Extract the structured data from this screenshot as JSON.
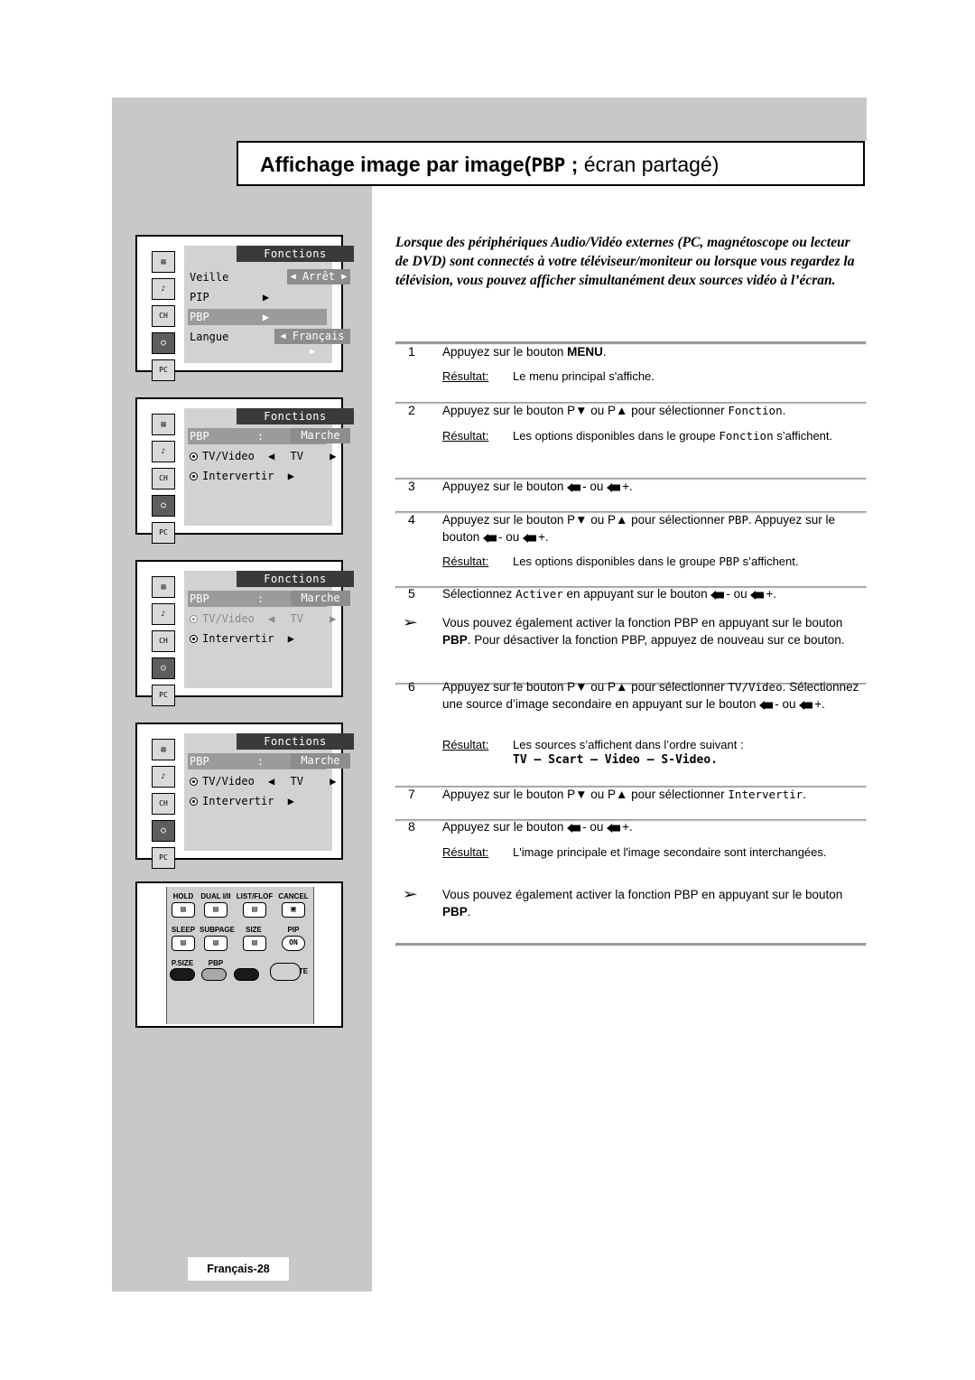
{
  "title": {
    "main": "Affichage image par image",
    "paren_open": "(",
    "mono": "PBP",
    "semi": " ; ",
    "light": "écran partagé",
    "paren_close": ")"
  },
  "intro": "Lorsque des périphériques Audio/Vidéo externes (PC, magnétoscope ou lecteur de DVD) sont connectés à votre téléviseur/moniteur ou lorsque vous regardez la télévision, vous pouvez afficher simultanément deux sources vidéo à l’écran.",
  "osd_panels": [
    {
      "name": "menu-fonctions-veille",
      "title": "Fonctions",
      "rows": [
        {
          "label": "Veille",
          "value": "Arrêt",
          "arrows": true,
          "highlight": false
        },
        {
          "label": "PIP",
          "value": "",
          "arrow_right": true,
          "highlight": false
        },
        {
          "label": "PBP",
          "value": "",
          "arrow_right": true,
          "highlight": true
        },
        {
          "label": "Langue",
          "value": "Français",
          "arrows": true,
          "highlight": false
        }
      ]
    },
    {
      "name": "menu-pbp-marche",
      "title": "Fonctions",
      "rows": [
        {
          "label": "PBP",
          "sep": ":",
          "value": "Marche",
          "highlight": true
        },
        {
          "label": "TV/Video",
          "value": "TV",
          "radio": true,
          "arrows": true
        },
        {
          "label": "Intervertir",
          "radio": true,
          "arrow_right": true
        }
      ]
    },
    {
      "name": "menu-pbp-tvvideo-dim",
      "title": "Fonctions",
      "rows": [
        {
          "label": "PBP",
          "sep": ":",
          "value": "Marche",
          "highlight": true
        },
        {
          "label": "TV/Video",
          "value": "TV",
          "radio": true,
          "arrows": true,
          "dim": true
        },
        {
          "label": "Intervertir",
          "radio": true,
          "arrow_right": true
        }
      ]
    },
    {
      "name": "menu-pbp-intervertir",
      "title": "Fonctions",
      "rows": [
        {
          "label": "PBP",
          "sep": ":",
          "value": "Marche",
          "highlight": true
        },
        {
          "label": "TV/Video",
          "value": "TV",
          "radio": true,
          "arrows": true
        },
        {
          "label": "Intervertir",
          "radio": true,
          "arrow_right": true
        }
      ]
    }
  ],
  "remote": {
    "name": "remote-control-diagram",
    "rows": [
      [
        "HOLD",
        "DUAL I/II",
        "LIST/FLOF",
        "CANCEL"
      ],
      [
        "SLEEP",
        "SUBPAGE",
        "SIZE",
        "PIP"
      ],
      [
        "P.SIZE",
        "PBP",
        "",
        "LOCATE"
      ]
    ],
    "pip_on_label": "ON"
  },
  "steps": [
    {
      "num": "1",
      "text_pre": "Appuyez sur le bouton ",
      "text_bold": "MENU",
      "text_post": ".",
      "result_label": "Résultat:",
      "result": "Le menu principal s'affiche."
    },
    {
      "num": "2",
      "text_pre": "Appuyez sur le bouton P▼ ou P▲ pour sélectionner ",
      "text_mono": "Fonction",
      "text_post": ".",
      "result_label": "Résultat:",
      "result_pre": "Les options disponibles dans le groupe ",
      "result_mono": "Fonction",
      "result_post": " s’affichent."
    },
    {
      "num": "3",
      "text_pre": "Appuyez sur le bouton ",
      "text_mid": "- ou ",
      "text_post": "+."
    },
    {
      "num": "4",
      "text_pre": "Appuyez sur le bouton P▼ ou P▲ pour sélectionner ",
      "text_mono": "PBP",
      "text_post": ". Appuyez sur le bouton ",
      "text_mid": "- ou ",
      "text_end": "+.",
      "result_label": "Résultat:",
      "result_pre": "Les options disponibles dans le groupe ",
      "result_mono": "PBP",
      "result_post": " s’affichent."
    },
    {
      "num": "5",
      "text_pre": "Sélectionnez ",
      "text_mono": "Activer",
      "text_post": " en appuyant sur le bouton ",
      "text_mid": "- ou ",
      "text_end": "+."
    },
    {
      "num": "6",
      "text_pre": "Appuyez sur le bouton P▼ ou P▲ pour sélectionner ",
      "text_mono": "TV/Video",
      "text_post": ". Sélectionnez une source d’image secondaire en appuyant sur le bouton ",
      "text_mid": "- ou ",
      "text_end": "+.",
      "result_label": "Résultat:",
      "result": "Les sources s’affichent dans l’ordre suivant :",
      "result_mono2": "TV – Scart – Video – S-Video."
    },
    {
      "num": "7",
      "text_pre": "Appuyez sur le bouton P▼ ou P▲ pour sélectionner ",
      "text_mono": "Intervertir",
      "text_post": "."
    },
    {
      "num": "8",
      "text_pre": "Appuyez sur le bouton ",
      "text_mid": "- ou ",
      "text_post": "+.",
      "result_label": "Résultat:",
      "result": "L'image principale et l'image secondaire sont interchangées."
    }
  ],
  "notes": [
    {
      "text_pre": "Vous pouvez également activer la fonction PBP en appuyant sur le bouton ",
      "text_bold": "PBP",
      "text_post": ". Pour désactiver la fonction PBP, appuyez de nouveau sur ce bouton."
    },
    {
      "text_pre": "Vous pouvez également activer la fonction PBP en appuyant sur le bouton ",
      "text_bold": "PBP",
      "text_post": "."
    }
  ],
  "footer": "Français-28"
}
